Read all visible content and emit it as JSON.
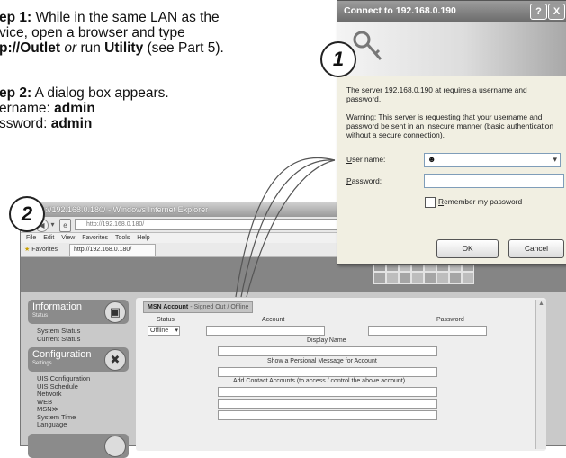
{
  "instructions": {
    "step1": {
      "label": "ep 1:",
      "text1": " While in the same LAN as the",
      "line2": "vice, open a browser and type",
      "line3_bold": "p://Outlet",
      "line3_or": "or",
      "line3_mid": " run ",
      "line3_util": "Utility",
      "line3_end": " (see Part 5)."
    },
    "step2": {
      "label": "ep 2:",
      "text1": " A dialog box appears.",
      "user_prefix": "ername: ",
      "user_value": "admin",
      "pass_prefix": "ssword: ",
      "pass_value": "admin"
    }
  },
  "badges": {
    "one": "1",
    "two": "2"
  },
  "browser": {
    "title": "p://192.168.0.180/ - Windows Internet Explorer",
    "address": "http://192.168.0.180/",
    "menu": [
      "File",
      "Edit",
      "View",
      "Favorites",
      "Tools",
      "Help"
    ],
    "favorites_label": "Favorites",
    "fav_tab": "http://192.168.0.180/",
    "sidebar": [
      {
        "title": "Information",
        "sub": "Status",
        "icon": "monitor-icon",
        "links": [
          "System Status",
          "Current Status"
        ]
      },
      {
        "title": "Configuration",
        "sub": "Settings",
        "icon": "tools-icon",
        "links": [
          "UIS Configuration",
          "UIS Schedule",
          "Network",
          "WEB",
          "MSN≫",
          "System Time",
          "Language"
        ]
      }
    ],
    "panel": {
      "tab_bold": "MSN Account",
      "tab_status": " - Signed Out / Offline",
      "col_status": "Status",
      "col_account": "Account",
      "col_password": "Password",
      "status_value": "Offline",
      "display_name": "Display Name",
      "personal_message": "Show a Persional Message for Account",
      "add_contacts": "Add Contact Accounts (to access / control the above account)"
    }
  },
  "dialog": {
    "title": "Connect to 192.168.0.190",
    "help_btn": "?",
    "close_btn": "X",
    "message": "The server 192.168.0.190 at  requires a username and password.",
    "warning": "Warning: This server is requesting that your username and password be sent in an insecure manner (basic authentication without a secure connection).",
    "username_label_u": "U",
    "username_label_rest": "ser name:",
    "password_label_u": "P",
    "password_label_rest": "assword:",
    "remember_u": "R",
    "remember_rest": "emember my password",
    "ok": "OK",
    "cancel": "Cancel"
  }
}
